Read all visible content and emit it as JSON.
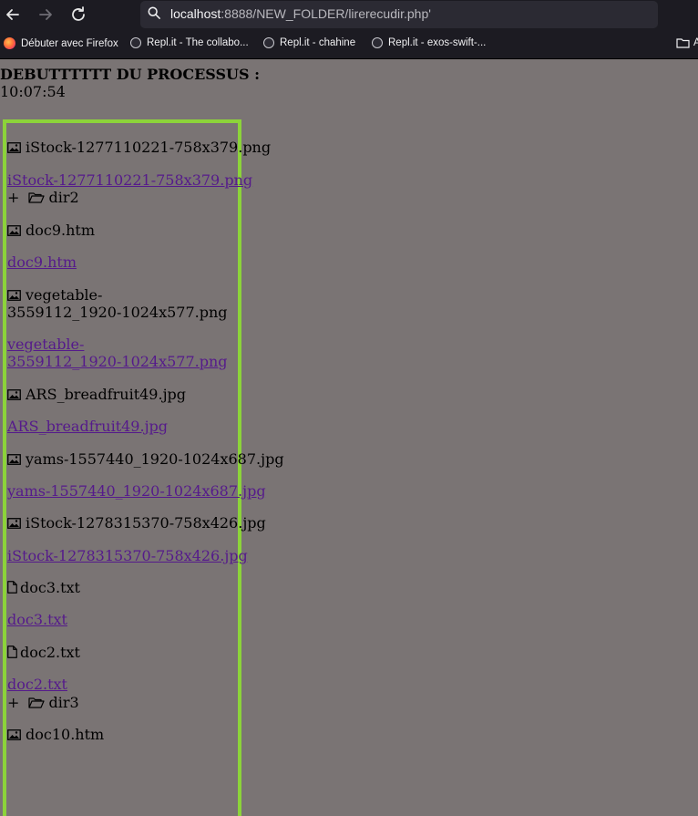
{
  "toolbar": {
    "back_icon": "arrow-left-icon",
    "forward_icon": "arrow-right-icon",
    "reload_icon": "reload-icon",
    "url_host": "localhost",
    "url_rest": ":8888/NEW_FOLDER/lirerecudir.php'"
  },
  "bookmarks": [
    {
      "label": "Débuter avec Firefox",
      "icon": "firefox-icon"
    },
    {
      "label": "Repl.it - The collabo...",
      "icon": "replit-icon"
    },
    {
      "label": "Repl.it - chahine",
      "icon": "replit-icon"
    },
    {
      "label": "Repl.it - exos-swift-...",
      "icon": "replit-icon"
    },
    {
      "label": "A",
      "icon": "folder-icon"
    }
  ],
  "page": {
    "heading": "DEBUTTTTTT DU PROCESSUS :",
    "time": "10:07:54"
  },
  "listing": {
    "colors": {
      "border": "#8cd33a",
      "link": "#551a8b",
      "background": "#7a7474"
    },
    "entries": [
      {
        "kind": "image",
        "icon": "image-icon",
        "name": "iStock-1277110221-758x379.png",
        "link": "iStock-1277110221-758x379.png"
      },
      {
        "kind": "dir",
        "icon": "folder-open-icon",
        "prefix": "+",
        "name": "dir2"
      },
      {
        "kind": "image",
        "icon": "image-icon",
        "name": "doc9.htm",
        "link": "doc9.htm"
      },
      {
        "kind": "image",
        "icon": "image-icon",
        "name_line1": "vegetable-",
        "name_line2": "3559112_1920-1024x577.png",
        "link_line1": "vegetable-",
        "link_line2": "3559112_1920-1024x577.png"
      },
      {
        "kind": "image",
        "icon": "image-icon",
        "name": "ARS_breadfruit49.jpg",
        "link": "ARS_breadfruit49.jpg"
      },
      {
        "kind": "image",
        "icon": "image-icon",
        "name": "yams-1557440_1920-1024x687.jpg",
        "link": "yams-1557440_1920-1024x687.jpg"
      },
      {
        "kind": "image",
        "icon": "image-icon",
        "name": "iStock-1278315370-758x426.jpg",
        "link": "iStock-1278315370-758x426.jpg"
      },
      {
        "kind": "file",
        "icon": "file-icon",
        "name": "doc3.txt",
        "link": "doc3.txt"
      },
      {
        "kind": "file",
        "icon": "file-icon",
        "name": "doc2.txt",
        "link": "doc2.txt"
      },
      {
        "kind": "dir",
        "icon": "folder-open-icon",
        "prefix": "+",
        "name": "dir3"
      },
      {
        "kind": "image",
        "icon": "image-icon",
        "name": "doc10.htm"
      }
    ]
  }
}
